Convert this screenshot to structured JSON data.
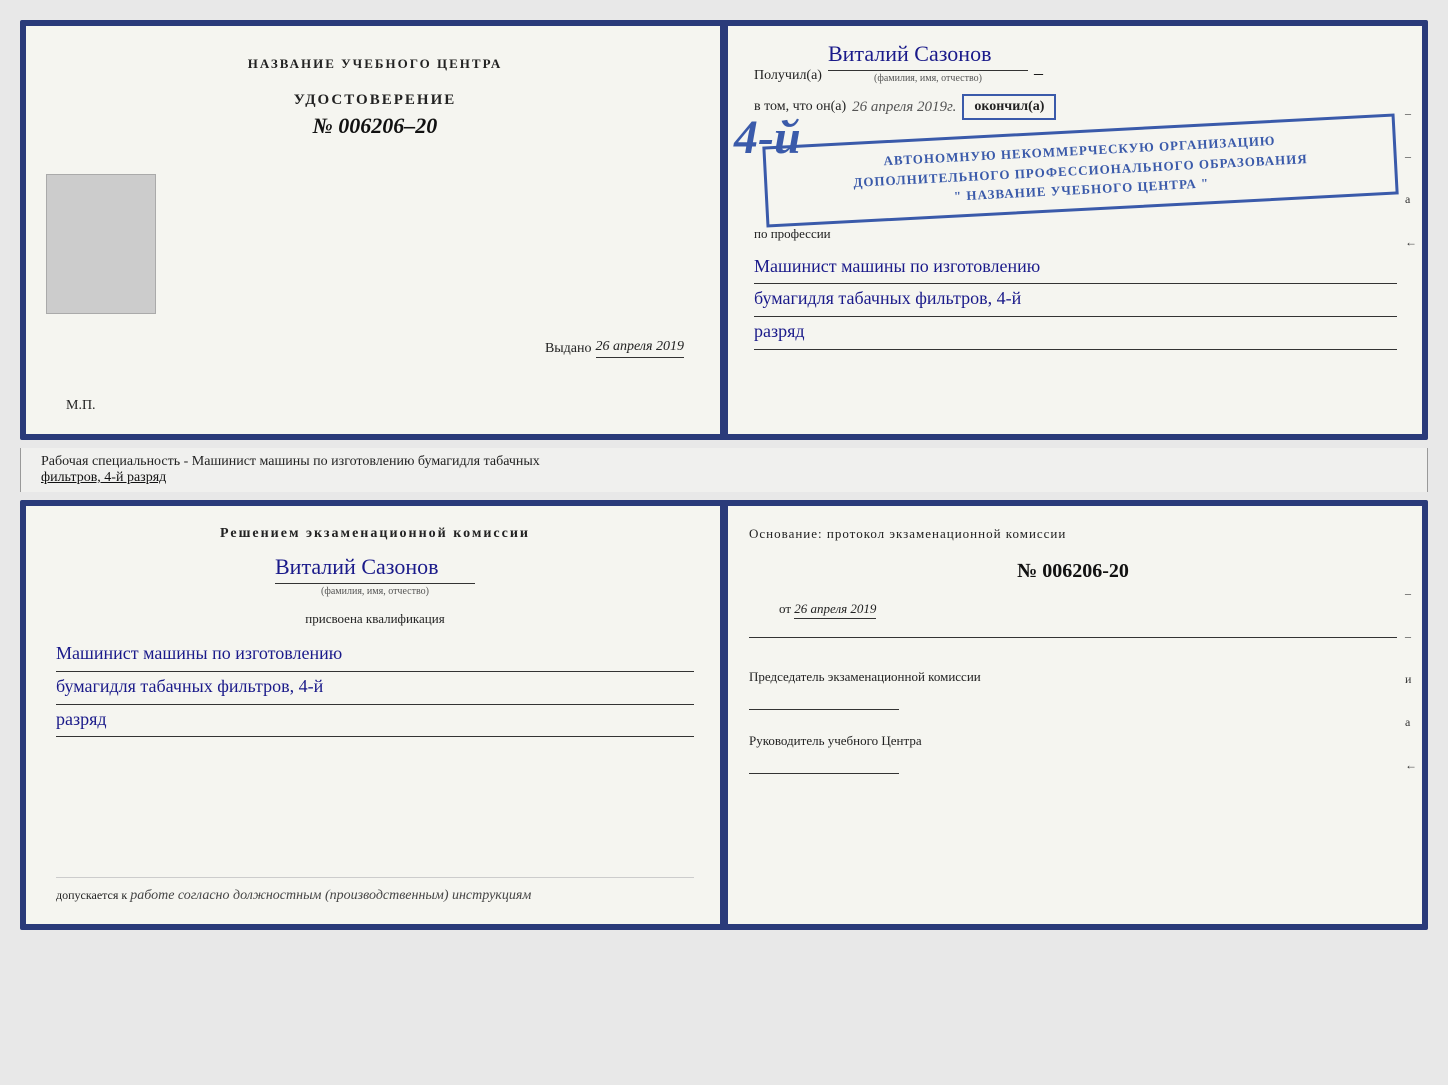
{
  "topDoc": {
    "left": {
      "title": "НАЗВАНИЕ УЧЕБНОГО ЦЕНТРА",
      "udostoverenie": "УДОСТОВЕРЕНИЕ",
      "number": "№ 006206–20",
      "vydano_label": "Выдано",
      "vydano_date": "26 апреля 2019",
      "mp": "М.П."
    },
    "right": {
      "poluchil": "Получил(а)",
      "name": "Виталий Сазонов",
      "fio_label": "(фамилия, имя, отчество)",
      "dash1": "–",
      "vtom": "в том, что он(а)",
      "date": "26 апреля 2019г.",
      "okoncil": "окончил(а)",
      "stamp_line1": "АВТОНОМНУЮ НЕКОММЕРЧЕСКУЮ ОРГАНИЗАЦИЮ",
      "stamp_line2": "ДОПОЛНИТЕЛЬНОГО ПРОФЕССИОНАЛЬНОГО ОБРАЗОВАНИЯ",
      "stamp_line3": "\" НАЗВАНИЕ УЧЕБНОГО ЦЕНТРА \"",
      "big_number": "4-й",
      "po_professii": "по профессии",
      "profession_line1": "Машинист машины по изготовлению",
      "profession_line2": "бумагидля табачных фильтров, 4-й",
      "profession_line3": "разряд",
      "side_marks": [
        "–",
        "–",
        "а",
        "←"
      ]
    }
  },
  "stripLabel": {
    "text_prefix": "Рабочая специальность - Машинист машины по изготовлению бумагидля табачных",
    "underline_part": "фильтров, 4-й разряд"
  },
  "bottomDoc": {
    "left": {
      "resheniem": "Решением экзаменационной комиссии",
      "name": "Виталий Сазонов",
      "fio_label": "(фамилия, имя, отчество)",
      "prisvoena": "присвоена квалификация",
      "qual_line1": "Машинист машины по изготовлению",
      "qual_line2": "бумагидля табачных фильтров, 4-й",
      "qual_line3": "разряд",
      "dopuskaetsya": "допускается к",
      "dopusk_italic": "работе согласно должностным (производственным) инструкциям"
    },
    "right": {
      "osnovanie": "Основание: протокол экзаменационной комиссии",
      "number": "№ 006206-20",
      "ot_label": "от",
      "ot_date": "26 апреля 2019",
      "predsedatel_label": "Председатель экзаменационной комиссии",
      "rukovoditel_label": "Руководитель учебного Центра",
      "side_marks": [
        "–",
        "–",
        "и",
        "а",
        "←"
      ]
    }
  }
}
